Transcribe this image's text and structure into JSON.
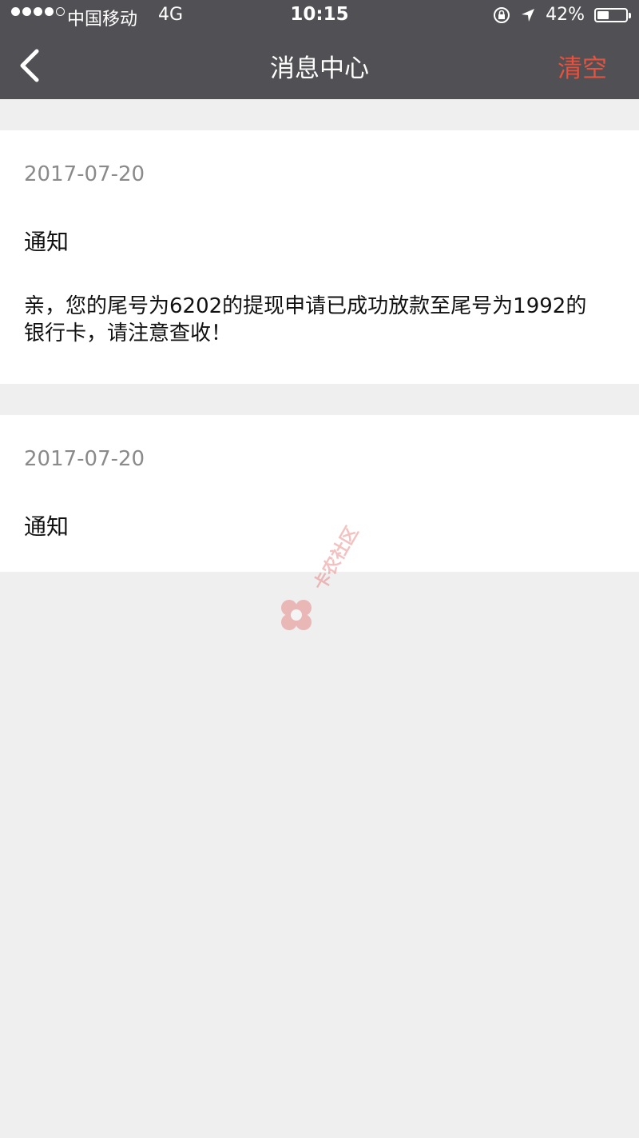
{
  "status_bar": {
    "carrier": "中国移动",
    "network": "4G",
    "time": "10:15",
    "battery_percent": "42%",
    "battery_level": 0.42,
    "signal_strength": 4
  },
  "nav": {
    "title": "消息中心",
    "clear_label": "清空"
  },
  "messages": [
    {
      "date": "2017-07-20",
      "title": "通知",
      "content": "亲，您的尾号为6202的提现申请已成功放款至尾号为1992的银行卡，请注意查收！"
    },
    {
      "date": "2017-07-20",
      "title": "通知"
    }
  ],
  "watermark": {
    "text": "卡农社区"
  },
  "colors": {
    "topbar": "#515054",
    "accent": "#e6523d",
    "background": "#efefef"
  }
}
